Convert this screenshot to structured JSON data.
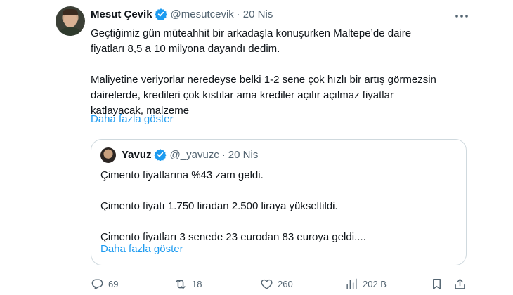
{
  "author": {
    "name": "Mesut Çevik",
    "handle": "@mesutcevik",
    "separator": "·",
    "date": "20 Nis"
  },
  "tweet": {
    "line1": "Geçtiğimiz gün müteahhit bir arkadaşla konuşurken Maltepe’de daire",
    "line2": "fiyatları 8,5 a 10 milyona dayandı dedim.",
    "line3": "Maliyetine veriyorlar neredeyse belki 1-2 sene çok hızlı bir artış görmezsin",
    "line4": "dairelerde, kredileri çok kıstılar ama krediler açılır açılmaz fiyatlar",
    "line5": "katlayacak, malzeme",
    "show_more": "Daha fazla göster"
  },
  "quote": {
    "name": "Yavuz",
    "handle": "@_yavuzc",
    "separator": "·",
    "date": "20 Nis",
    "line1": "Çimento fiyatlarına %43 zam geldi.",
    "line2": "Çimento fiyatı 1.750 liradan 2.500 liraya yükseltildi.",
    "line3": "Çimento fiyatları  3 senede 23 eurodan 83 euroya geldi....",
    "show_more": "Daha fazla göster"
  },
  "actions": {
    "replies": "69",
    "retweets": "18",
    "likes": "260",
    "views": "202 B"
  },
  "icons": {
    "verified": "verified-badge-icon",
    "more": "more-dots-icon",
    "reply": "reply-icon",
    "retweet": "retweet-icon",
    "like": "heart-icon",
    "views": "views-bar-chart-icon",
    "bookmark": "bookmark-icon",
    "share": "share-icon"
  },
  "colors": {
    "accent": "#1d9bf0",
    "secondary_text": "#536471",
    "border": "#cfd9de"
  }
}
